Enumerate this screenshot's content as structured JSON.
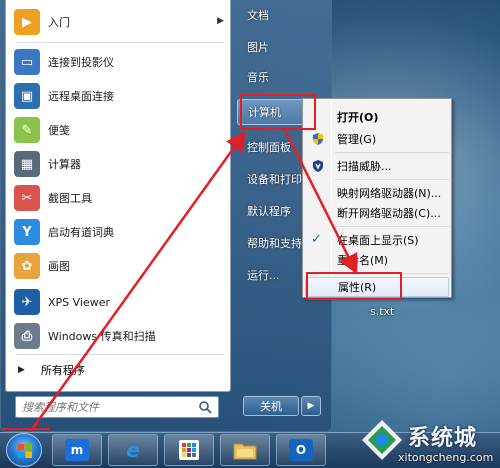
{
  "desktop": {
    "file_label": "s.txt"
  },
  "start_menu": {
    "programs": [
      {
        "label": "入门",
        "icon": "getting-started-icon",
        "color": "#f0a020",
        "has_arrow": true
      },
      {
        "label": "连接到投影仪",
        "icon": "projector-icon",
        "color": "#3b78c3",
        "has_arrow": false
      },
      {
        "label": "远程桌面连接",
        "icon": "remote-desktop-icon",
        "color": "#2f6fb0",
        "has_arrow": false
      },
      {
        "label": "便笺",
        "icon": "sticky-notes-icon",
        "color": "#8bc34a",
        "has_arrow": false
      },
      {
        "label": "计算器",
        "icon": "calculator-icon",
        "color": "#5a6a7a",
        "has_arrow": false
      },
      {
        "label": "截图工具",
        "icon": "snipping-tool-icon",
        "color": "#d9534f",
        "has_arrow": false
      },
      {
        "label": "启动有道词典",
        "icon": "youdao-dict-icon",
        "color": "#2a8be0",
        "has_arrow": false
      },
      {
        "label": "画图",
        "icon": "paint-icon",
        "color": "#e8a33d",
        "has_arrow": false
      },
      {
        "label": "XPS Viewer",
        "icon": "xps-viewer-icon",
        "color": "#1f5fa8",
        "has_arrow": false
      },
      {
        "label": "Windows 传真和扫描",
        "icon": "fax-scan-icon",
        "color": "#6b7b8b",
        "has_arrow": false
      }
    ],
    "all_programs": "所有程序",
    "search_placeholder": "搜索程序和文件",
    "right_items": [
      {
        "label": "文档",
        "selected": false
      },
      {
        "label": "图片",
        "selected": false
      },
      {
        "label": "音乐",
        "selected": false
      },
      {
        "label": "计算机",
        "selected": true
      },
      {
        "label": "控制面板",
        "selected": false
      },
      {
        "label": "设备和打印机",
        "selected": false
      },
      {
        "label": "默认程序",
        "selected": false
      },
      {
        "label": "帮助和支持",
        "selected": false
      },
      {
        "label": "运行...",
        "selected": false
      }
    ],
    "shutdown_label": "关机"
  },
  "context_menu": {
    "items": [
      {
        "label": "打开(O)",
        "bold": true,
        "icon": ""
      },
      {
        "label": "管理(G)",
        "bold": false,
        "icon": "shield-icon"
      },
      {
        "label": "扫描威胁...",
        "bold": false,
        "icon": "antivirus-shield-icon"
      },
      {
        "label": "映射网络驱动器(N)...",
        "bold": false,
        "icon": ""
      },
      {
        "label": "断开网络驱动器(C)...",
        "bold": false,
        "icon": ""
      },
      {
        "label": "在桌面上显示(S)",
        "bold": false,
        "icon": "checkmark-icon"
      },
      {
        "label": "重命名(M)",
        "bold": false,
        "icon": ""
      },
      {
        "label": "属性(R)",
        "bold": false,
        "icon": ""
      }
    ]
  },
  "taskbar": {
    "apps": [
      {
        "name": "thunder-app-icon",
        "color": "#1e6fd9",
        "glyph": "m"
      },
      {
        "name": "internet-explorer-icon",
        "color": "#2d8fe0",
        "glyph": "e"
      },
      {
        "name": "app-grid-icon",
        "color": "#ffffff",
        "glyph": ""
      },
      {
        "name": "windows-explorer-icon",
        "color": "#e8c25a",
        "glyph": ""
      },
      {
        "name": "outlook-icon",
        "color": "#1565c0",
        "glyph": "O"
      }
    ]
  },
  "watermark": {
    "text": "系统城",
    "url": "xitongcheng.com"
  },
  "colors": {
    "annotation_red": "#e31e24",
    "taskbar_blue": "#2a5a8a"
  }
}
